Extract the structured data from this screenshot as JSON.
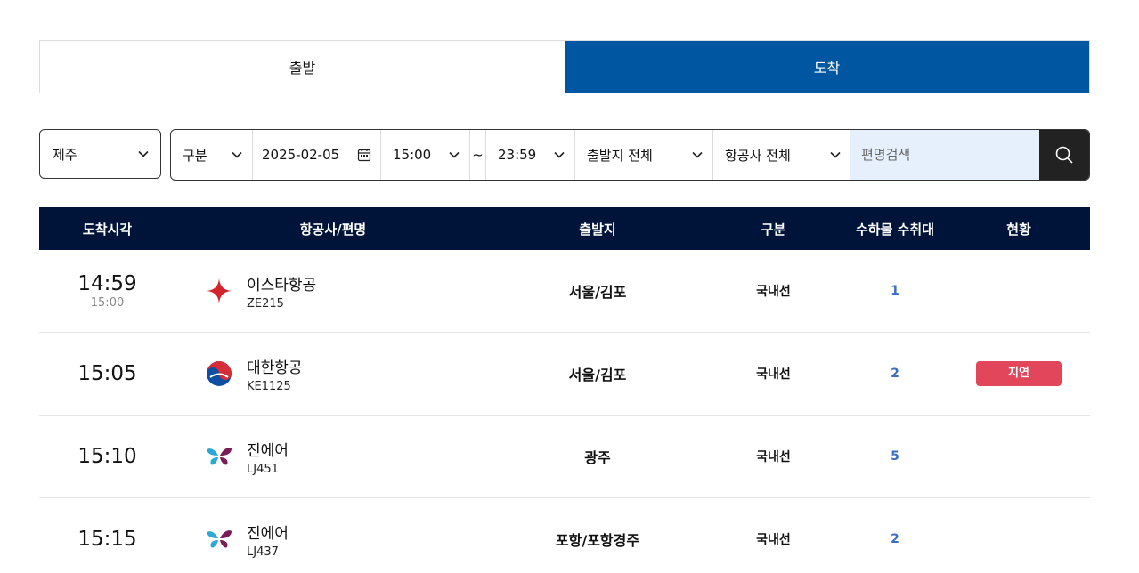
{
  "tabs": [
    {
      "label": "출발",
      "active": false
    },
    {
      "label": "도착",
      "active": true
    }
  ],
  "filters": {
    "airport": "제주",
    "type": "구분",
    "date": "2025-02-05",
    "time_from": "15:00",
    "tilde": "~",
    "time_to": "23:59",
    "origin": "출발지 전체",
    "airline": "항공사 전체",
    "search_placeholder": "편명검색"
  },
  "table": {
    "headers": [
      "도착시각",
      "항공사/편명",
      "출발지",
      "구분",
      "수하물 수취대",
      "현황"
    ],
    "rows": [
      {
        "time": "14:59",
        "scheduled": "15:00",
        "airline": "이스타항공",
        "flight": "ZE215",
        "logo": "eastar-star-icon",
        "origin": "서울/김포",
        "kind": "국내선",
        "belt": "1",
        "status": ""
      },
      {
        "time": "15:05",
        "scheduled": "",
        "airline": "대한항공",
        "flight": "KE1125",
        "logo": "korean-air-taegeuk-icon",
        "origin": "서울/김포",
        "kind": "국내선",
        "belt": "2",
        "status": "지연"
      },
      {
        "time": "15:10",
        "scheduled": "",
        "airline": "진에어",
        "flight": "LJ451",
        "logo": "jinair-butterfly-icon",
        "origin": "광주",
        "kind": "국내선",
        "belt": "5",
        "status": ""
      },
      {
        "time": "15:15",
        "scheduled": "",
        "airline": "진에어",
        "flight": "LJ437",
        "logo": "jinair-butterfly-icon",
        "origin": "포항/포항경주",
        "kind": "국내선",
        "belt": "2",
        "status": ""
      }
    ]
  },
  "colors": {
    "active_tab": "#0056a0",
    "table_header": "#001439",
    "delay_badge": "#e2465a",
    "belt_text": "#3a6fc4",
    "search_bg": "#e6f0fc"
  }
}
